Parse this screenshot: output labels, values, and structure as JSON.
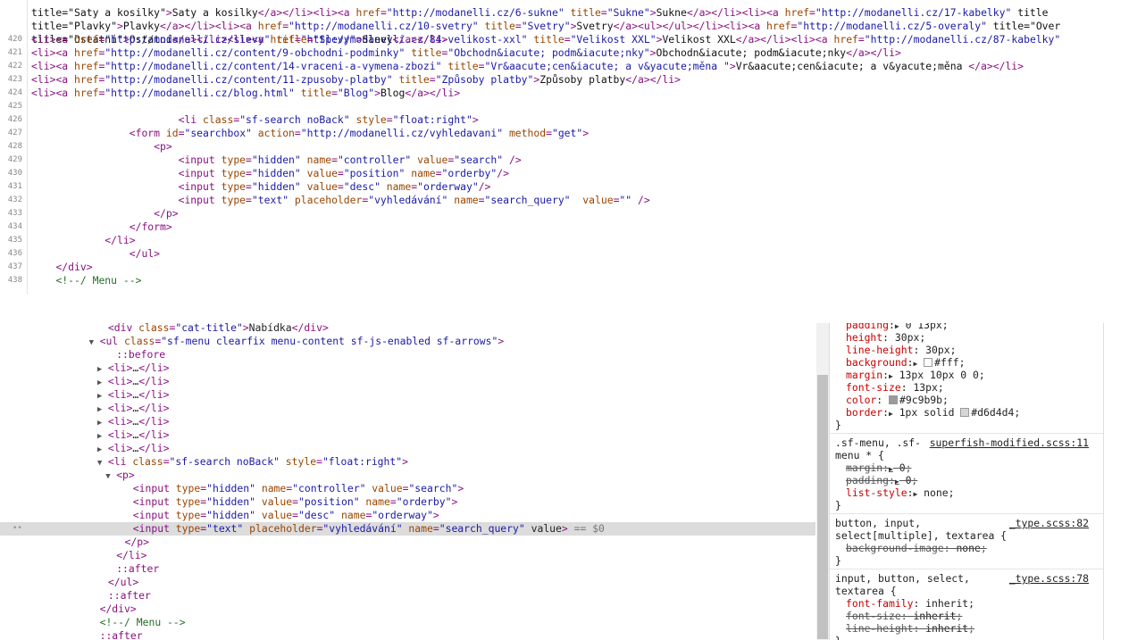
{
  "source_view": {
    "line0": "title=\"Saty a kosilky\">Saty a kosilky</a></li><li><a href=\"http://modanelli.cz/6-sukne\" title=\"Sukne\">Sukne</a></li><li><a href=\"http://modanelli.cz/17-kabelky\" title",
    "line1": "title=\"Plavky\">Plavky</a></li><li><a href=\"http://modanelli.cz/10-svetry\" title=\"Svetry\">Svetry</a><ul></ul></li><li><a href=\"http://modanelli.cz/5-overaly\" title=\"Over",
    "line2": "title=\"Ostatní\">Ostatní</a></li><li><a href=\"http://modanelli.cz/84-velikost-xxl\" title=\"Velikost XXL\">Velikost XXL</a></li><li><a href=\"http://modanelli.cz/87-kabelky\"",
    "lines": [
      {
        "n": "420",
        "code": "<li><a href=\"http://modanelli.cz/slevy\" title=\"Slevy\">Slevy</a></li>"
      },
      {
        "n": "421",
        "code": "<li><a href=\"http://modanelli.cz/content/9-obchodni-podminky\" title=\"Obchodn&iacute; podm&iacute;nky\">Obchodn&iacute; podm&iacute;nky</a></li>"
      },
      {
        "n": "422",
        "code": "<li><a href=\"http://modanelli.cz/content/14-vraceni-a-vymena-zbozi\" title=\"Vr&aacute;cen&iacute; a v&yacute;měna \">Vr&aacute;cen&iacute; a v&yacute;měna </a></li>"
      },
      {
        "n": "423",
        "code": "<li><a href=\"http://modanelli.cz/content/11-zpusoby-platby\" title=\"Způsoby platby\">Způsoby platby</a></li>"
      },
      {
        "n": "424",
        "code": "<li><a href=\"http://modanelli.cz/blog.html\" title=\"Blog\">Blog</a></li>"
      },
      {
        "n": "425",
        "code": ""
      },
      {
        "n": "426",
        "code": "                        <li class=\"sf-search noBack\" style=\"float:right\">"
      },
      {
        "n": "427",
        "code": "                <form id=\"searchbox\" action=\"http://modanelli.cz/vyhledavani\" method=\"get\">"
      },
      {
        "n": "428",
        "code": "                    <p>"
      },
      {
        "n": "429",
        "code": "                        <input type=\"hidden\" name=\"controller\" value=\"search\" />"
      },
      {
        "n": "430",
        "code": "                        <input type=\"hidden\" value=\"position\" name=\"orderby\"/>"
      },
      {
        "n": "431",
        "code": "                        <input type=\"hidden\" value=\"desc\" name=\"orderway\"/>"
      },
      {
        "n": "432",
        "code": "                        <input type=\"text\" placeholder=\"vyhledávání\" name=\"search_query\"  value=\"\" />"
      },
      {
        "n": "433",
        "code": "                    </p>"
      },
      {
        "n": "434",
        "code": "                </form>"
      },
      {
        "n": "435",
        "code": "            </li>"
      },
      {
        "n": "436",
        "code": "                </ul>"
      },
      {
        "n": "437",
        "code": "    </div>"
      },
      {
        "n": "438",
        "code": "    <!--/ Menu -->"
      }
    ]
  },
  "elements_panel": {
    "lines": [
      {
        "indent": 13,
        "tri": "",
        "text": "<div class=\"cat-title\">Nabídka</div>"
      },
      {
        "indent": 12,
        "tri": "▼",
        "text": "<ul class=\"sf-menu clearfix menu-content sf-js-enabled sf-arrows\">"
      },
      {
        "indent": 14,
        "tri": "",
        "text": "::before"
      },
      {
        "indent": 13,
        "tri": "▶",
        "text": "<li>…</li>"
      },
      {
        "indent": 13,
        "tri": "▶",
        "text": "<li>…</li>"
      },
      {
        "indent": 13,
        "tri": "▶",
        "text": "<li>…</li>"
      },
      {
        "indent": 13,
        "tri": "▶",
        "text": "<li>…</li>"
      },
      {
        "indent": 13,
        "tri": "▶",
        "text": "<li>…</li>"
      },
      {
        "indent": 13,
        "tri": "▶",
        "text": "<li>…</li>"
      },
      {
        "indent": 13,
        "tri": "▶",
        "text": "<li>…</li>"
      },
      {
        "indent": 13,
        "tri": "▼",
        "text": "<li class=\"sf-search noBack\" style=\"float:right\">"
      },
      {
        "indent": 14,
        "tri": "▼",
        "text": "<p>"
      },
      {
        "indent": 16,
        "tri": "",
        "text": "<input type=\"hidden\" name=\"controller\" value=\"search\">"
      },
      {
        "indent": 16,
        "tri": "",
        "text": "<input type=\"hidden\" value=\"position\" name=\"orderby\">"
      },
      {
        "indent": 16,
        "tri": "",
        "text": "<input type=\"hidden\" value=\"desc\" name=\"orderway\">"
      },
      {
        "indent": 16,
        "tri": "",
        "text": "<input type=\"text\" placeholder=\"vyhledávání\" name=\"search_query\" value>",
        "selected": true,
        "suffix": " == $0"
      },
      {
        "indent": 15,
        "tri": "",
        "text": "</p>"
      },
      {
        "indent": 14,
        "tri": "",
        "text": "</li>"
      },
      {
        "indent": 14,
        "tri": "",
        "text": "::after"
      },
      {
        "indent": 13,
        "tri": "",
        "text": "</ul>"
      },
      {
        "indent": 13,
        "tri": "",
        "text": "::after"
      },
      {
        "indent": 12,
        "tri": "",
        "text": "</div>"
      },
      {
        "indent": 12,
        "tri": "",
        "text": "<!--/ Menu -->"
      },
      {
        "indent": 12,
        "tri": "",
        "text": "::after"
      }
    ]
  },
  "styles_panel": {
    "rule1": [
      {
        "prop": "padding",
        "val": "0 13px",
        "tri": true
      },
      {
        "prop": "height",
        "val": "30px"
      },
      {
        "prop": "line-height",
        "val": "30px"
      },
      {
        "prop": "background",
        "val": "#fff",
        "tri": true,
        "swatch": "#ffffff"
      },
      {
        "prop": "margin",
        "val": "13px 10px 0 0",
        "tri": true
      },
      {
        "prop": "font-size",
        "val": "13px"
      },
      {
        "prop": "color",
        "val": "#9c9b9b",
        "swatch": "#9c9b9b"
      },
      {
        "prop": "border",
        "val": "1px solid",
        "tri": true,
        "swatch": "#d6d4d4",
        "extra": "#d6d4d4"
      }
    ],
    "rule2": {
      "selector1": ".sf-menu, .sf-",
      "selector2": "menu * {",
      "source": "superfish-modified.scss:11",
      "props": [
        {
          "prop": "margin",
          "val": "0",
          "tri": true,
          "strike": true
        },
        {
          "prop": "padding",
          "val": "0",
          "tri": true,
          "strike": true
        },
        {
          "prop": "list-style",
          "val": "none",
          "tri": true
        }
      ]
    },
    "rule3": {
      "selector1": "button, input,",
      "selector2": "select[multiple], textarea {",
      "source": "_type.scss:82",
      "props": [
        {
          "prop": "background-image",
          "val": "none",
          "strike": true
        }
      ]
    },
    "rule4": {
      "selector1": "input, button, select,",
      "selector2": "textarea {",
      "source": "_type.scss:78",
      "props": [
        {
          "prop": "font-family",
          "val": "inherit"
        },
        {
          "prop": "font-size",
          "val": "inherit",
          "strike": true
        },
        {
          "prop": "line-height",
          "val": "inherit",
          "strike": true
        }
      ]
    },
    "close_brace": "}"
  }
}
